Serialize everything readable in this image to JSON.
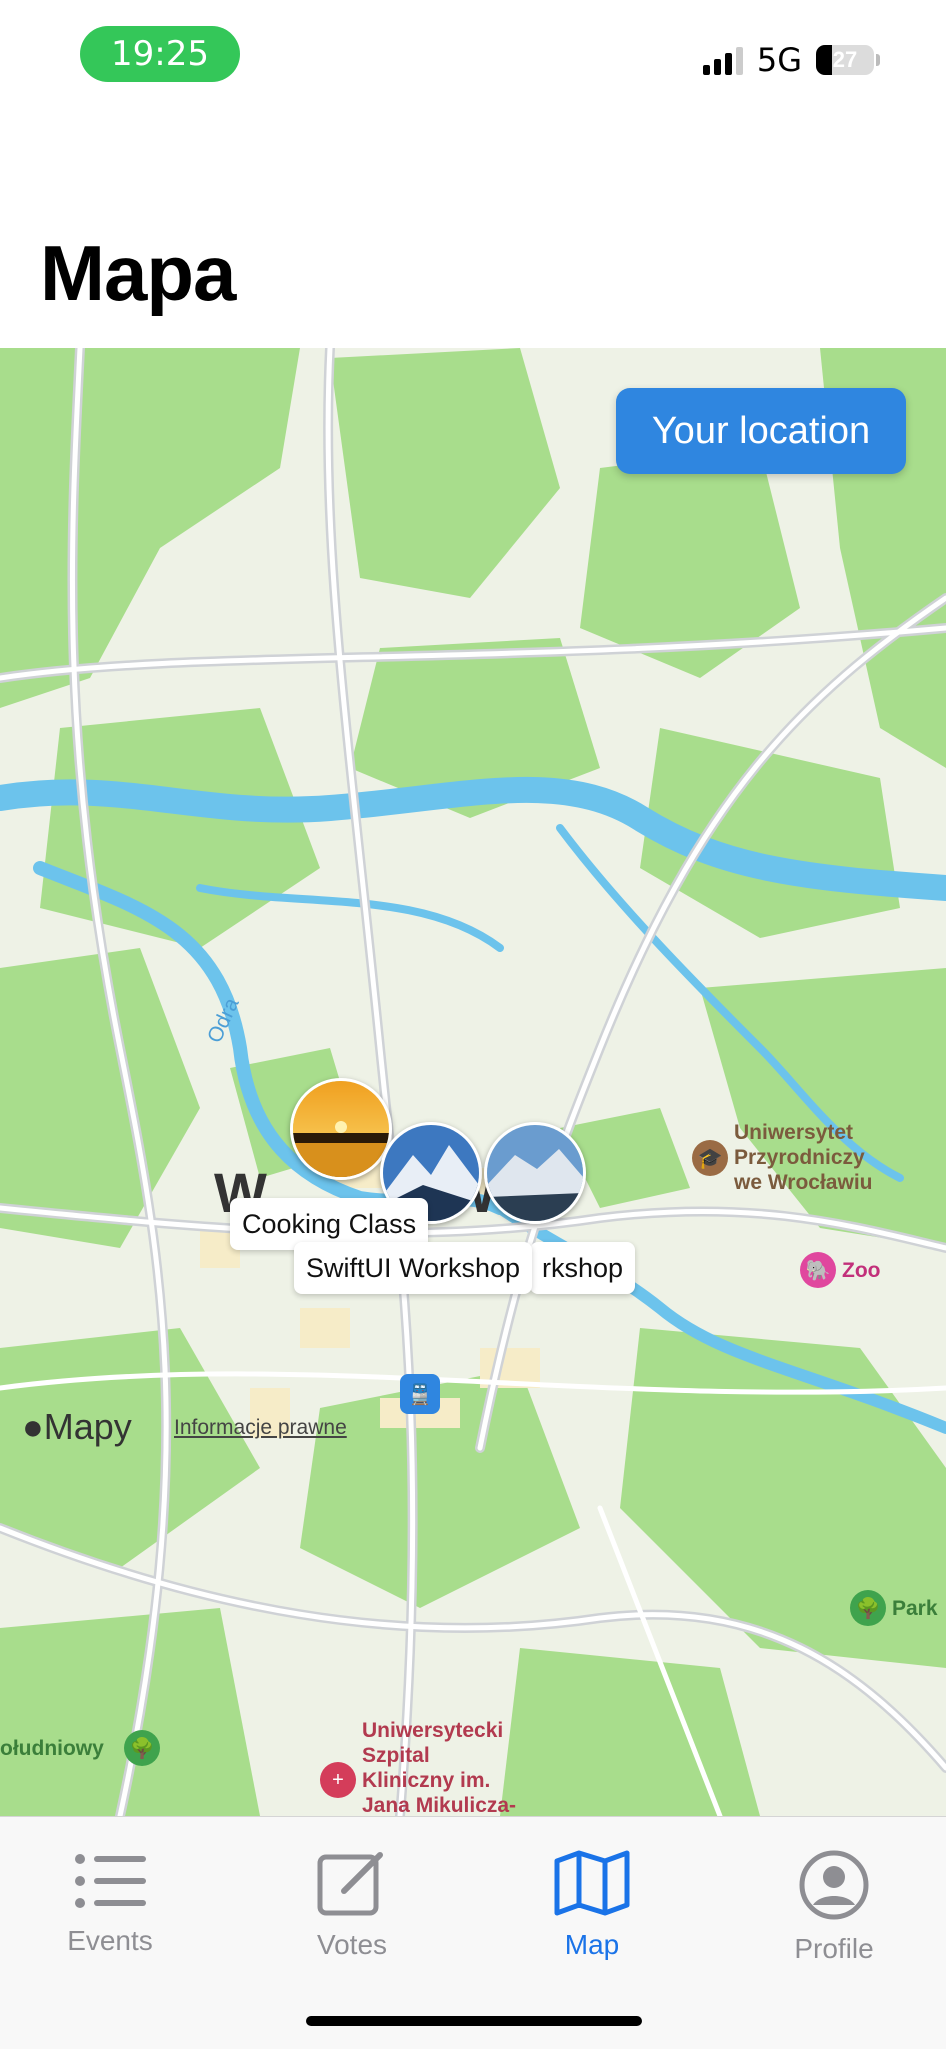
{
  "status_bar": {
    "time": "19:25",
    "network": "5G",
    "battery": "27"
  },
  "page_title": "Mapa",
  "map": {
    "location_button": "Your location",
    "river_label": "Odra",
    "city_letters": [
      "W",
      "W"
    ],
    "pois": [
      {
        "name": "Uniwersytet Przyrodniczy we Wrocławiu",
        "lines": [
          "Uniwersytet",
          "Przyrodniczy",
          "we Wrocławiu"
        ],
        "icon": "graduation-cap-icon"
      },
      {
        "name": "Zoo",
        "icon": "elephant-icon"
      },
      {
        "name": "Park",
        "icon": "tree-icon"
      },
      {
        "name": "Uniwersytecki Szpital Kliniczny im. Jana Mikulicza-",
        "lines": [
          "Uniwersytecki",
          "Szpital",
          "Kliniczny im.",
          "Jana Mikulicza-"
        ],
        "icon": "hospital-icon"
      },
      {
        "name": "Południowy",
        "lines": [
          "ołudniowy"
        ],
        "icon": "tree-icon"
      }
    ],
    "events": [
      {
        "title": "Cooking Class",
        "image": "sunset-photo"
      },
      {
        "title": "SwiftUI Workshop",
        "image": "mountain-photo"
      },
      {
        "title": "rkshop",
        "image": "mountain-photo"
      }
    ],
    "attribution": {
      "brand": "Mapy",
      "legal": "Informacje prawne"
    }
  },
  "tabs": [
    {
      "label": "Events",
      "icon": "list-icon",
      "active": false
    },
    {
      "label": "Votes",
      "icon": "compose-icon",
      "active": false
    },
    {
      "label": "Map",
      "icon": "map-icon",
      "active": true
    },
    {
      "label": "Profile",
      "icon": "person-circle-icon",
      "active": false
    }
  ],
  "colors": {
    "accent": "#1a73e8",
    "green_time": "#34c759",
    "button_blue": "#2f86e0",
    "park_green": "#a8dd8c",
    "water_blue": "#6cc3ec"
  }
}
